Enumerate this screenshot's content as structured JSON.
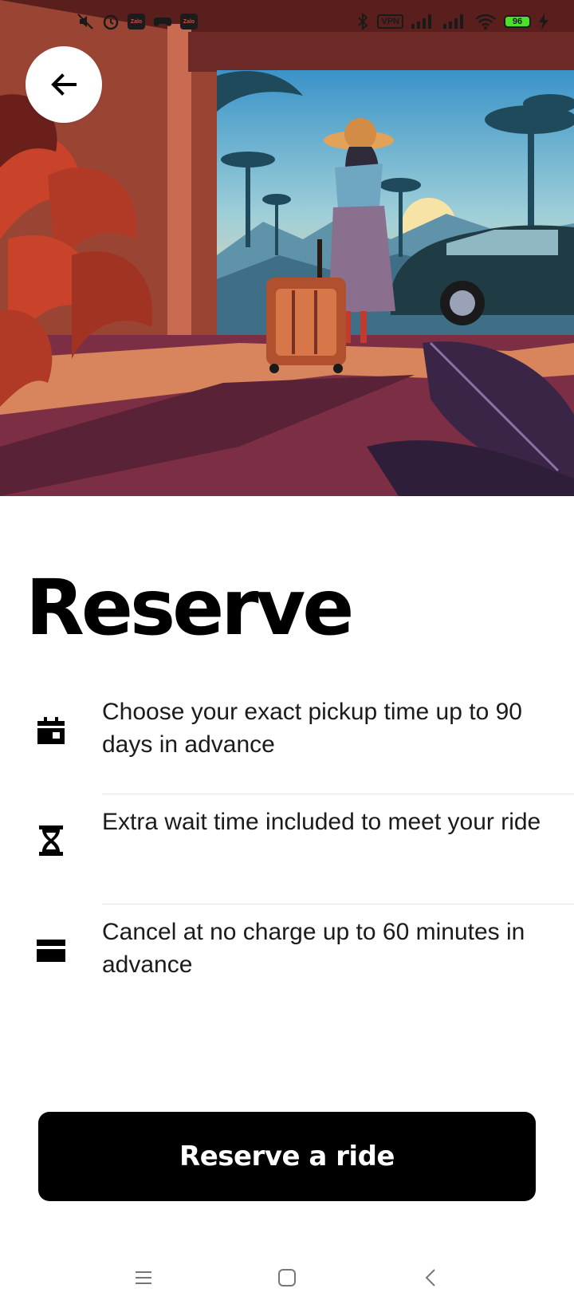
{
  "status_bar": {
    "left_apps": [
      "Zalo",
      "Zalo"
    ],
    "vpn_label": "VPN",
    "battery_level": "96"
  },
  "page": {
    "title": "Reserve"
  },
  "features": [
    {
      "icon": "calendar-icon",
      "text": "Choose your exact pickup time up to 90 days in advance"
    },
    {
      "icon": "hourglass-icon",
      "text": "Extra wait time included to meet your ride"
    },
    {
      "icon": "card-icon",
      "text": "Cancel at no charge up to 60 minutes in advance"
    }
  ],
  "primary_action": {
    "label": "Reserve a ride"
  },
  "navigation": {
    "items": [
      "menu-icon",
      "home-icon",
      "back-icon"
    ]
  },
  "colors": {
    "button_bg": "#000000",
    "button_text": "#ffffff",
    "battery": "#4ce02a",
    "hero_sky_top": "#3a93c9",
    "hero_floor": "#7c2f44"
  }
}
